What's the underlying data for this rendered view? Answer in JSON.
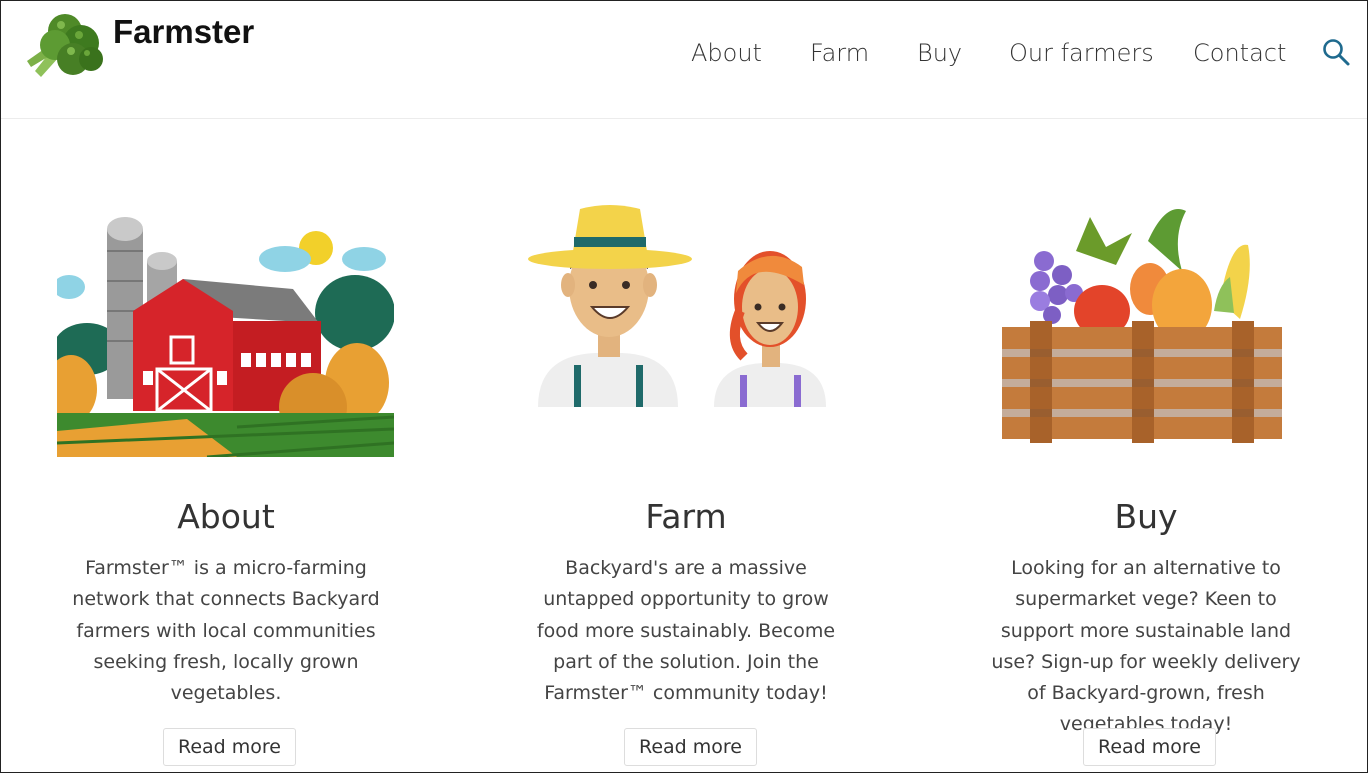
{
  "brand": {
    "name": "Farmster"
  },
  "nav": {
    "items": [
      "About",
      "Farm",
      "Buy",
      "Our farmers",
      "Contact"
    ]
  },
  "icons": {
    "search": "search-icon",
    "logo": "broccoli-icon"
  },
  "colors": {
    "accent": "#1f6a8e",
    "text": "#333333",
    "barn": "#d6242a"
  },
  "cards": [
    {
      "title": "About",
      "text": "Farmster™ is a micro-farming network that connects Backyard farmers with local communities seeking fresh, locally grown vegetables.",
      "button": "Read more"
    },
    {
      "title": "Farm",
      "text": "Backyard's are a massive untapped opportunity to grow food more sustainably. Become part of the solution. Join the Farmster™ community today!",
      "button": "Read more"
    },
    {
      "title": "Buy",
      "text": "Looking for an alternative to supermarket vege? Keen to support more sustainable land use? Sign-up for weekly delivery of Backyard-grown, fresh vegetables today!",
      "button": "Read more"
    }
  ]
}
